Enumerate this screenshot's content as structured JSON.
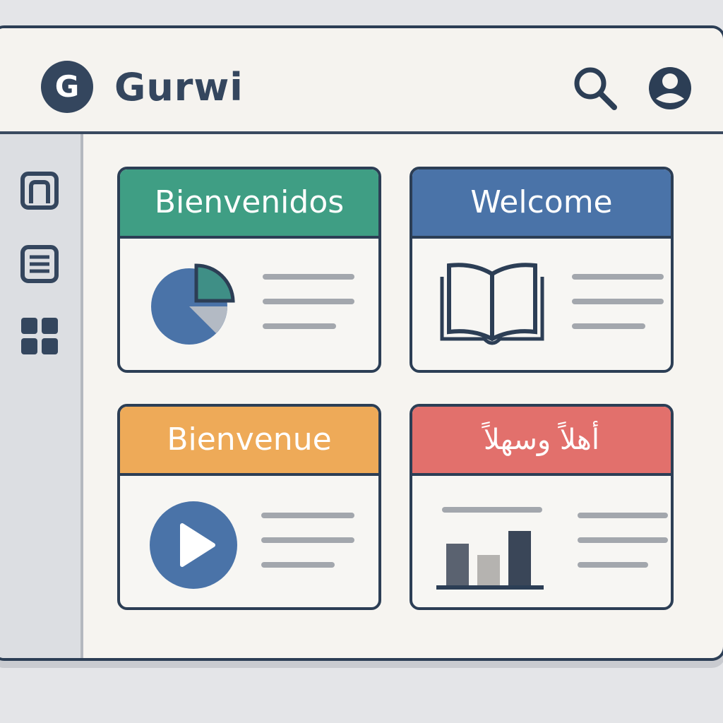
{
  "app": {
    "logo_letter": "G",
    "title": "Gurwi"
  },
  "header": {
    "icons": [
      "search-icon",
      "user-icon"
    ]
  },
  "sidebar": {
    "icons": [
      "home-icon",
      "list-icon",
      "grid-icon"
    ]
  },
  "cards": [
    {
      "title": "Bienvenidos",
      "color": "#3f9e84",
      "visual": "pie-chart-icon"
    },
    {
      "title": "Welcome",
      "color": "#4a73a8",
      "visual": "open-book-icon"
    },
    {
      "title": "Bienvenue",
      "color": "#eeaa58",
      "visual": "play-icon"
    },
    {
      "title": "أهلاً وسهلاً",
      "color": "#e2706c",
      "visual": "bar-chart-icon"
    }
  ],
  "colors": {
    "primary_dark": "#2c3e55",
    "accent_blue": "#4a73a8",
    "placeholder_line": "#a3a7ad"
  }
}
